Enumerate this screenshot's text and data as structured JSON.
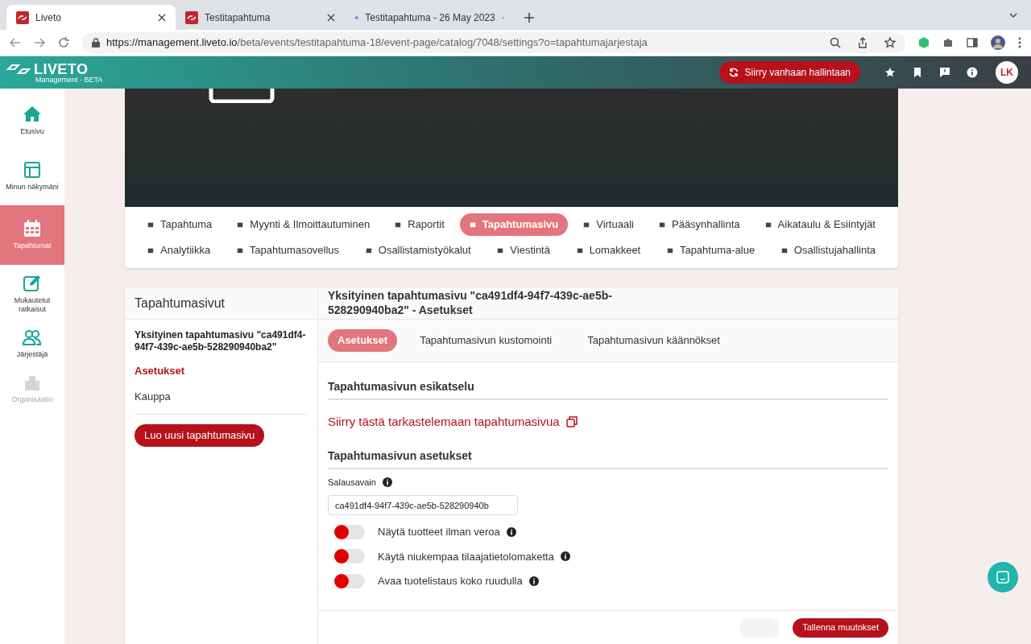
{
  "browser": {
    "tabs": [
      {
        "title": "Liveto",
        "selected": true
      },
      {
        "title": "Testitapahtuma",
        "selected": false
      },
      {
        "title": "Testitapahtuma - 26 May 2023",
        "selected": false
      }
    ],
    "url_host": "https://management.liveto.io",
    "url_path": "/beta/events/testitapahtuma-18/event-page/catalog/7048/settings?o=tapahtumajarjestaja"
  },
  "header": {
    "logo": "LIVETO",
    "logo_sub": "Management - BETA",
    "old_admin_button": "Siirry vanhaan hallintaan",
    "avatar": "LK"
  },
  "sidebar": {
    "items": [
      {
        "label": "Etusivu",
        "selected": false,
        "disabled": false
      },
      {
        "label": "Minun näkymäni",
        "selected": false,
        "disabled": false
      },
      {
        "label": "Tapahtumat",
        "selected": true,
        "disabled": false
      },
      {
        "label": "Mukautetut ratkaisut",
        "selected": false,
        "disabled": false
      },
      {
        "label": "Järjestäjä",
        "selected": false,
        "disabled": false
      },
      {
        "label": "Organisaatio",
        "selected": false,
        "disabled": true
      }
    ]
  },
  "nav_tabs": [
    {
      "label": "Tapahtuma",
      "selected": false
    },
    {
      "label": "Myynti & Ilmoittautuminen",
      "selected": false
    },
    {
      "label": "Raportit",
      "selected": false
    },
    {
      "label": "Tapahtumasivu",
      "selected": true
    },
    {
      "label": "Virtuaali",
      "selected": false
    },
    {
      "label": "Pääsynhallinta",
      "selected": false
    },
    {
      "label": "Aikataulu & Esiintyjät",
      "selected": false
    },
    {
      "label": "Analytiikka",
      "selected": false
    },
    {
      "label": "Tapahtumasovellus",
      "selected": false
    },
    {
      "label": "Osallistamistyökalut",
      "selected": false
    },
    {
      "label": "Viestintä",
      "selected": false
    },
    {
      "label": "Lomakkeet",
      "selected": false
    },
    {
      "label": "Tapahtuma-alue",
      "selected": false
    },
    {
      "label": "Osallistujahallinta",
      "selected": false
    }
  ],
  "left_panel": {
    "title": "Tapahtumasivut",
    "page_name": "Yksityinen tapahtumasivu \"ca491df4-94f7-439c-ae5b-528290940ba2\"",
    "items": [
      {
        "label": "Asetukset",
        "selected": true
      },
      {
        "label": "Kauppa",
        "selected": false
      }
    ],
    "new_button": "Luo uusi tapahtumasivu"
  },
  "main": {
    "title": "Yksityinen tapahtumasivu \"ca491df4-94f7-439c-ae5b-528290940ba2\" - Asetukset",
    "tabs": [
      {
        "label": "Asetukset",
        "selected": true
      },
      {
        "label": "Tapahtumasivun kustomointi",
        "selected": false
      },
      {
        "label": "Tapahtumasivun käännökset",
        "selected": false
      }
    ],
    "preview_heading": "Tapahtumasivun esikatselu",
    "preview_link": "Siirry tästä tarkastelemaan tapahtumasivua",
    "settings_heading": "Tapahtumasivun asetukset",
    "key_label": "Salausavain",
    "key_value": "ca491df4-94f7-439c-ae5b-528290940b",
    "toggles": [
      {
        "label": "Näytä tuotteet ilman veroa",
        "on": false
      },
      {
        "label": "Käytä niukempaa tilaajatietolomaketta",
        "on": false
      },
      {
        "label": "Avaa tuotelistaus koko ruudulla",
        "on": false
      }
    ],
    "save_button": "Tallenna muutokset"
  }
}
